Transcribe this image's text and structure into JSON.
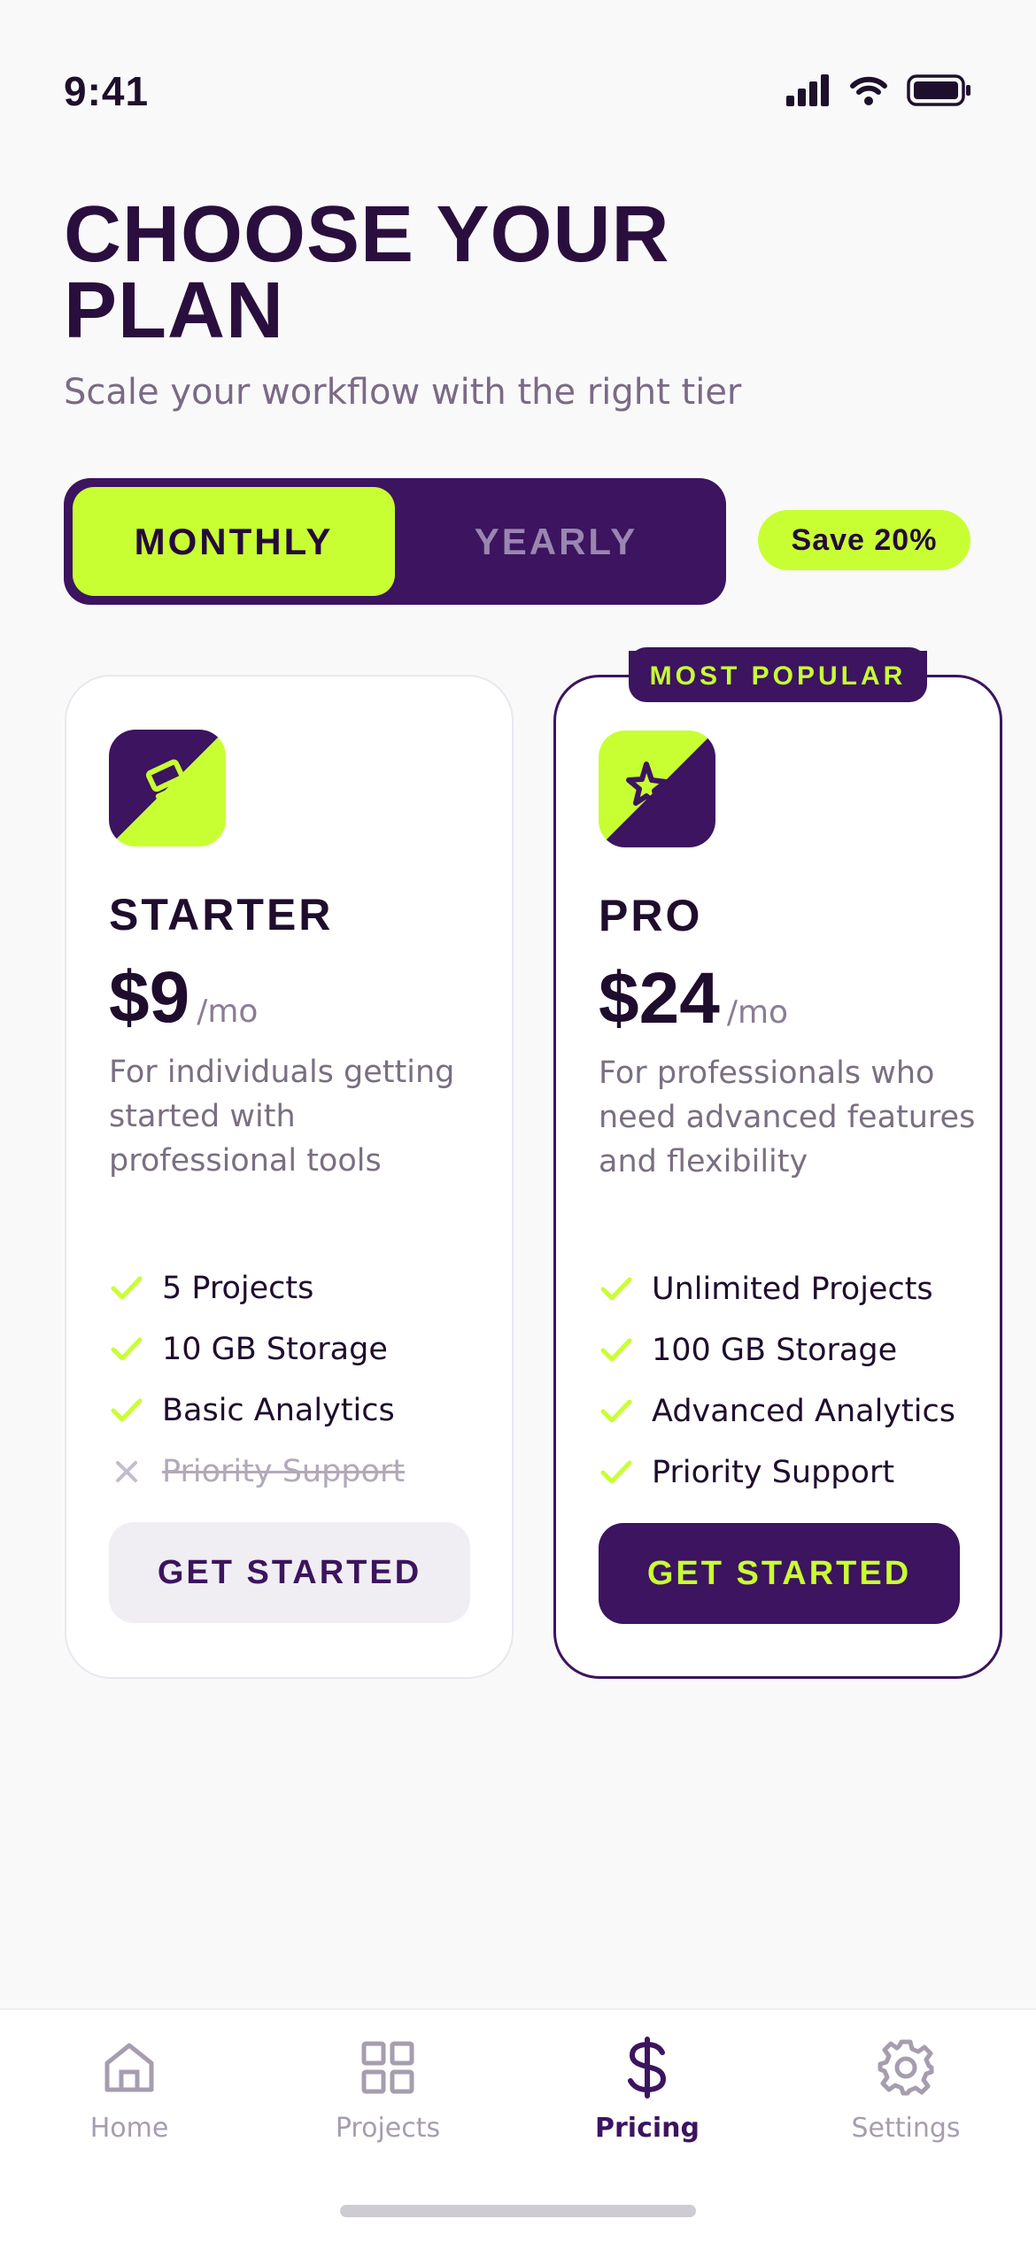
{
  "status_bar": {
    "time": "9:41"
  },
  "header": {
    "title": "CHOOSE YOUR PLAN",
    "subtitle": "Scale your workflow with the right tier"
  },
  "billing": {
    "monthly_label": "MONTHLY",
    "yearly_label": "YEARLY",
    "selected": "monthly",
    "save_badge": "Save 20%"
  },
  "plans": [
    {
      "name": "STARTER",
      "price": "$9",
      "period": "/mo",
      "description": "For individuals getting started with professional tools",
      "icon": "layers-icon",
      "features": [
        {
          "label": "5 Projects",
          "included": true
        },
        {
          "label": "10 GB Storage",
          "included": true
        },
        {
          "label": "Basic Analytics",
          "included": true
        },
        {
          "label": "Priority Support",
          "included": false
        }
      ],
      "cta": "GET STARTED"
    },
    {
      "name": "PRO",
      "price": "$24",
      "period": "/mo",
      "description": "For professionals who need advanced features and flexibility",
      "icon": "sparkle-star-icon",
      "badge": "MOST POPULAR",
      "features": [
        {
          "label": "Unlimited Projects",
          "included": true
        },
        {
          "label": "100 GB Storage",
          "included": true
        },
        {
          "label": "Advanced Analytics",
          "included": true
        },
        {
          "label": "Priority Support",
          "included": true
        }
      ],
      "cta": "GET STARTED"
    }
  ],
  "tab_bar": {
    "items": [
      {
        "label": "Home",
        "icon": "home-icon",
        "active": false
      },
      {
        "label": "Projects",
        "icon": "grid-icon",
        "active": false
      },
      {
        "label": "Pricing",
        "icon": "dollar-icon",
        "active": true
      },
      {
        "label": "Settings",
        "icon": "gear-icon",
        "active": false
      }
    ]
  },
  "colors": {
    "primary": "#3c145f",
    "accent": "#c8ff33",
    "background": "#f9f9fa"
  }
}
